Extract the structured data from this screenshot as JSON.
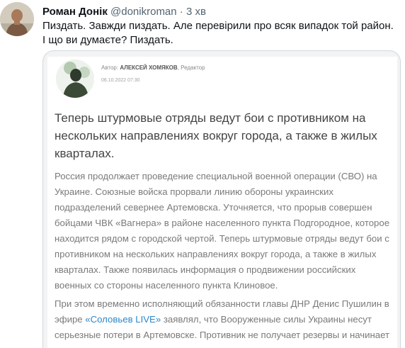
{
  "tweet": {
    "display_name": "Роман Донік",
    "handle": "@donikroman",
    "separator": "·",
    "time": "3 хв",
    "text_line1": "Пиздать. Завжди пиздать. Але перевірили про всяк випадок той район.",
    "text_line2": "І що ви думаєте? Пиздать."
  },
  "article": {
    "author_prefix": "Автор:",
    "author_name": "АЛЕКСЕЙ ХОМЯКОВ",
    "author_role": ", Редактор",
    "date": "06.10.2022 07:30",
    "lead": "Теперь штурмовые отряды ведут бои с противником на нескольких направлениях вокруг города, а также в жилых кварталах.",
    "paragraph1": "Россия продолжает проведение специальной военной операции (СВО) на Украине. Союзные войска прорвали линию обороны украинских подразделений севернее Артемовска. Уточняется, что прорыв совершен бойцами ЧВК «Вагнера» в районе населенного пункта Подгородное, которое находится рядом с городской чертой. Теперь штурмовые отряды ведут бои с противником на нескольких направлениях вокруг города, а также в жилых кварталах. Также появилась информация о продвижении российских военных со стороны населенного пункта Клиновое.",
    "paragraph2_before": "При этом временно исполняющий обязанности главы ДНР Денис Пушилин в эфире ",
    "paragraph2_link": "«Соловьев LIVE»",
    "paragraph2_after": " заявлял, что Вооруженные силы Украины несут серьезные потери в Артемовске. Противник не получает резервы и начинает"
  },
  "colors": {
    "link": "#2f86c9",
    "secondary_text": "#536471",
    "border": "#cfd9de"
  }
}
